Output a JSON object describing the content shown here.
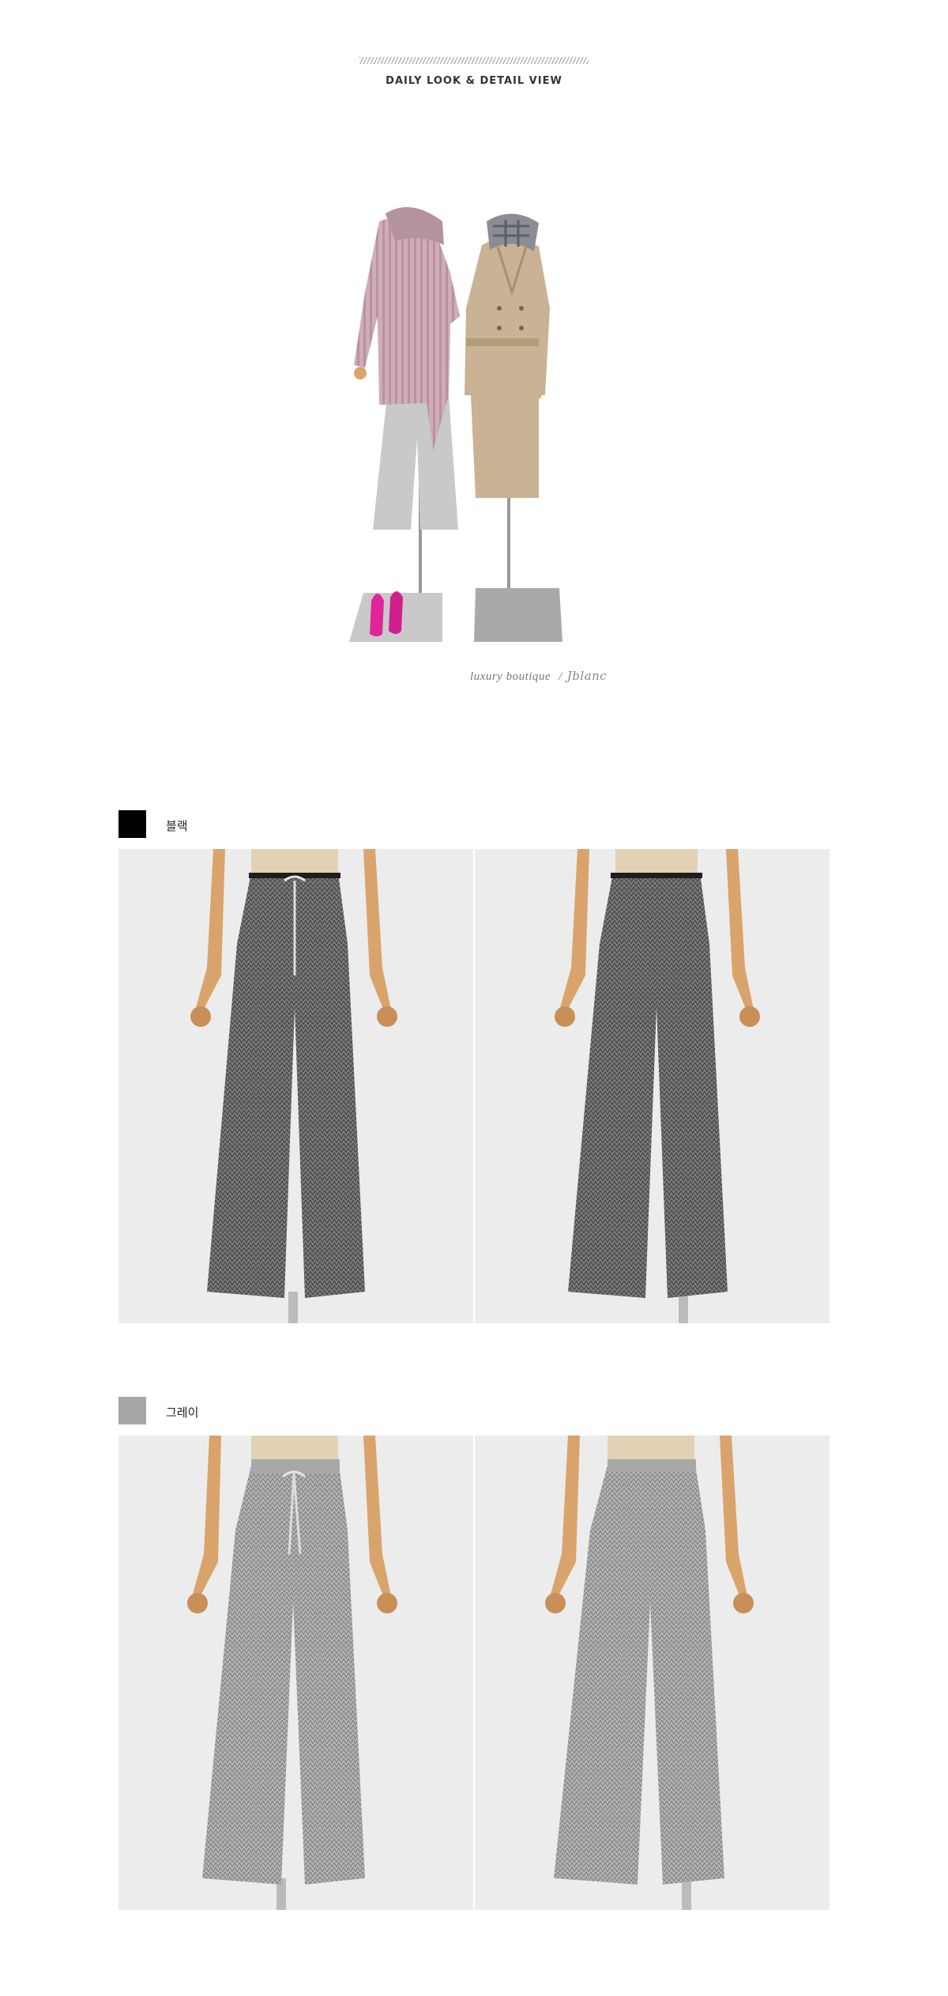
{
  "header": {
    "title": "DAILY LOOK & DETAIL VIEW"
  },
  "brand": {
    "tagline": "luxury boutique",
    "separator": "/",
    "signature": "Jblanc"
  },
  "colors": [
    {
      "name": "블랙",
      "swatch": "#000000"
    },
    {
      "name": "그레이",
      "swatch": "#a6a6a6"
    }
  ],
  "palette": {
    "photo_background": "#ececec",
    "pants_dark": "#6c6c6c",
    "pants_light": "#a4a4a4",
    "mannequin_wood": "#d9a46c",
    "sweater_pink": "#cba9b4",
    "coat_beige": "#c9b394",
    "shoes_magenta": "#e0259a"
  }
}
